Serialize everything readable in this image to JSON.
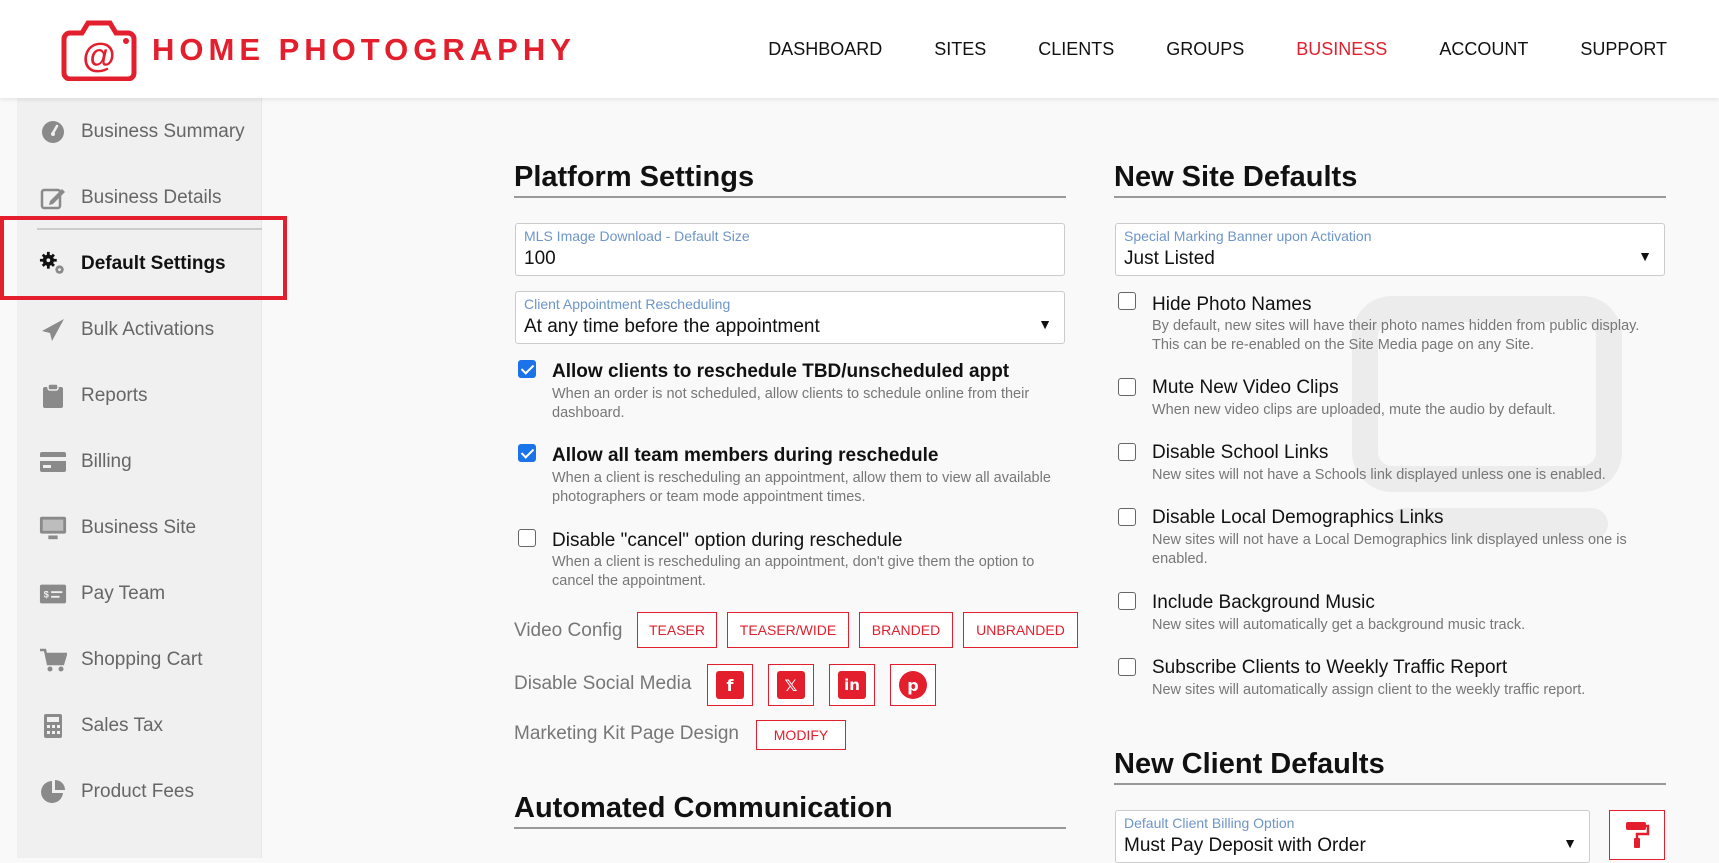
{
  "header": {
    "brand": "HOME PHOTOGRAPHY",
    "logo_icon": "camera-at-logo-icon",
    "nav": [
      "DASHBOARD",
      "SITES",
      "CLIENTS",
      "GROUPS",
      "BUSINESS",
      "ACCOUNT",
      "SUPPORT"
    ],
    "active_nav": "BUSINESS",
    "accent": "#e31e2d"
  },
  "sidebar": {
    "items": [
      {
        "label": "Business Summary",
        "icon": "gauge-icon"
      },
      {
        "label": "Business Details",
        "icon": "edit-icon"
      },
      {
        "label": "Default Settings",
        "icon": "gears-icon"
      },
      {
        "label": "Bulk Activations",
        "icon": "paper-plane-icon"
      },
      {
        "label": "Reports",
        "icon": "clipboard-icon"
      },
      {
        "label": "Billing",
        "icon": "credit-card-icon"
      },
      {
        "label": "Business Site",
        "icon": "monitor-icon"
      },
      {
        "label": "Pay Team",
        "icon": "money-check-icon"
      },
      {
        "label": "Shopping Cart",
        "icon": "cart-icon"
      },
      {
        "label": "Sales Tax",
        "icon": "calculator-icon"
      },
      {
        "label": "Product Fees",
        "icon": "pie-chart-icon"
      }
    ],
    "active": "Default Settings"
  },
  "platform": {
    "title": "Platform Settings",
    "mls": {
      "label": "MLS Image Download - Default Size",
      "value": "100"
    },
    "reschedule": {
      "label": "Client Appointment Rescheduling",
      "value": "At any time before the appointment"
    },
    "checks": [
      {
        "title": "Allow clients to reschedule TBD/unscheduled appt",
        "desc": "When an order is not scheduled, allow clients to schedule online from their dashboard.",
        "checked": true
      },
      {
        "title": "Allow all team members during reschedule",
        "desc": "When a client is rescheduling an appointment, allow them to view all available photographers or team mode appointment times.",
        "checked": true
      },
      {
        "title": "Disable \"cancel\" option during reschedule",
        "desc": "When a client is rescheduling an appointment, don't give them the option to cancel the appointment.",
        "checked": false
      }
    ],
    "video_config": {
      "label": "Video Config",
      "buttons": [
        "TEASER",
        "TEASER/WIDE",
        "BRANDED",
        "UNBRANDED"
      ]
    },
    "social": {
      "label": "Disable Social Media",
      "icons": [
        "facebook-icon",
        "x-twitter-icon",
        "linkedin-icon",
        "pinterest-icon"
      ]
    },
    "marketing": {
      "label": "Marketing Kit Page Design",
      "button": "MODIFY"
    }
  },
  "automated": {
    "title": "Automated Communication"
  },
  "site_defaults": {
    "title": "New Site Defaults",
    "banner": {
      "label": "Special Marking Banner upon Activation",
      "value": "Just Listed"
    },
    "checks": [
      {
        "title": "Hide Photo Names",
        "desc": "By default, new sites will have their photo names hidden from public display. This can be re-enabled on the Site Media page on any Site.",
        "checked": false
      },
      {
        "title": "Mute New Video Clips",
        "desc": "When new video clips are uploaded, mute the audio by default.",
        "checked": false
      },
      {
        "title": "Disable School Links",
        "desc": "New sites will not have a Schools link displayed unless one is enabled.",
        "checked": false
      },
      {
        "title": "Disable Local Demographics Links",
        "desc": "New sites will not have a Local Demographics link displayed unless one is enabled.",
        "checked": false
      },
      {
        "title": "Include Background Music",
        "desc": "New sites will automatically get a background music track.",
        "checked": false
      },
      {
        "title": "Subscribe Clients to Weekly Traffic Report",
        "desc": "New sites will automatically assign client to the weekly traffic report.",
        "checked": false
      }
    ]
  },
  "client_defaults": {
    "title": "New Client Defaults",
    "billing": {
      "label": "Default Client Billing Option",
      "value": "Must Pay Deposit with Order"
    },
    "paint_icon": "paint-roller-icon"
  }
}
